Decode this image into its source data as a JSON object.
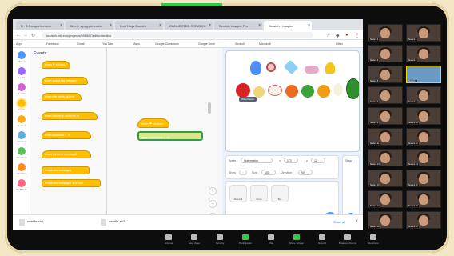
{
  "browser": {
    "tabs": [
      {
        "label": "B · 8 Comprehension",
        "active": false
      },
      {
        "label": "Meet - wpxg-ybm-wkm",
        "active": false
      },
      {
        "label": "Fruit Ninja Scratch",
        "active": false
      },
      {
        "label": "CONNECTED SCRATCH",
        "active": false
      },
      {
        "label": "Scratch Imagine Pro",
        "active": false
      },
      {
        "label": "Scratch - Imagine",
        "active": true
      }
    ],
    "url": "scratch.mit.edu/projects/596567/editor/#editor",
    "bookmarks": [
      "Apps",
      "Facebook",
      "Gmail",
      "YouTube",
      "Maps",
      "Google Classroom",
      "Google Drive",
      "Scratch",
      "Microsoft",
      "Other"
    ]
  },
  "scratch": {
    "categories": [
      {
        "label": "Motion",
        "color": "#4c97ff"
      },
      {
        "label": "Looks",
        "color": "#9966ff"
      },
      {
        "label": "Sound",
        "color": "#cf63cf"
      },
      {
        "label": "Events",
        "color": "#ffbf00"
      },
      {
        "label": "Control",
        "color": "#ffab19"
      },
      {
        "label": "Sensing",
        "color": "#5cb1d6"
      },
      {
        "label": "Operators",
        "color": "#59c059"
      },
      {
        "label": "Variables",
        "color": "#ff8c1a"
      },
      {
        "label": "My Blocks",
        "color": "#ff6680"
      }
    ],
    "palette_title": "Events",
    "palette_blocks": [
      {
        "text": "when ⚑ clicked",
        "hat": true
      },
      {
        "text": "when space key pressed",
        "hat": true
      },
      {
        "text": "when this sprite clicked",
        "hat": true
      },
      {
        "text": "when backdrop switches to",
        "hat": true
      },
      {
        "text": "when loudness > 10",
        "hat": true
      },
      {
        "text": "when I receive message1",
        "hat": true
      },
      {
        "text": "broadcast message1",
        "hat": false
      },
      {
        "text": "broadcast message1 and wait",
        "hat": false
      }
    ],
    "workspace_blocks": [
      {
        "text": "when ⚑ clicked"
      },
      {
        "text": "when loudness > 10"
      }
    ],
    "stage_tag": "Watermelon",
    "sprite_info": {
      "sprite_label": "Sprite",
      "sprite_name": "Watermelon",
      "x_label": "x",
      "x_value": "173",
      "y_label": "y",
      "y_value": "12",
      "show_label": "Show",
      "size_label": "Size",
      "size_value": "100",
      "direction_label": "Direction",
      "direction_value": "90"
    },
    "sprites": [
      "Diamond",
      "Donut",
      "Bell"
    ],
    "stage_label": "Stage",
    "colors": {
      "events": "#ffbf00",
      "selected": "#2e9e44",
      "accent": "#4c97ff"
    }
  },
  "downloads": [
    {
      "name": "webfile.sb3"
    },
    {
      "name": "webfile.sb3"
    }
  ],
  "downloads_show_all": "Show all",
  "zoom_controls": [
    "Unmute",
    "Stop Video",
    "Security",
    "Participants",
    "Chat",
    "Share Screen",
    "Record",
    "Breakout Rooms",
    "Reactions"
  ],
  "participants": [
    "Student 1",
    "Student 2",
    "Student 3",
    "Student 4",
    "Student 5",
    "Student 6",
    "Student 7",
    "Student 8",
    "Student 9",
    "Student 10",
    "Student 11",
    "Student 12",
    "Student 13",
    "Student 14",
    "Student 15",
    "Student 16",
    "Student 17",
    "Student 18",
    "Student 19",
    "Student 20",
    "Student 21",
    "Student 22"
  ]
}
